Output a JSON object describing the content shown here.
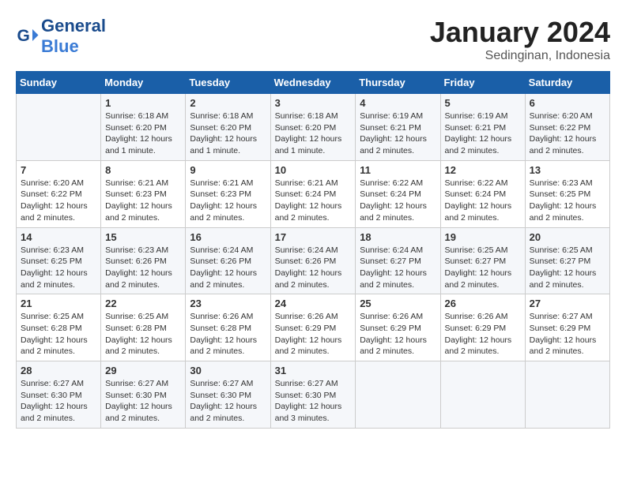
{
  "logo": {
    "general": "General",
    "blue": "Blue"
  },
  "title": "January 2024",
  "location": "Sedinginan, Indonesia",
  "days": [
    "Sunday",
    "Monday",
    "Tuesday",
    "Wednesday",
    "Thursday",
    "Friday",
    "Saturday"
  ],
  "weeks": [
    [
      {
        "day": "",
        "content": ""
      },
      {
        "day": "1",
        "content": "Sunrise: 6:18 AM\nSunset: 6:20 PM\nDaylight: 12 hours\nand 1 minute."
      },
      {
        "day": "2",
        "content": "Sunrise: 6:18 AM\nSunset: 6:20 PM\nDaylight: 12 hours\nand 1 minute."
      },
      {
        "day": "3",
        "content": "Sunrise: 6:18 AM\nSunset: 6:20 PM\nDaylight: 12 hours\nand 1 minute."
      },
      {
        "day": "4",
        "content": "Sunrise: 6:19 AM\nSunset: 6:21 PM\nDaylight: 12 hours\nand 2 minutes."
      },
      {
        "day": "5",
        "content": "Sunrise: 6:19 AM\nSunset: 6:21 PM\nDaylight: 12 hours\nand 2 minutes."
      },
      {
        "day": "6",
        "content": "Sunrise: 6:20 AM\nSunset: 6:22 PM\nDaylight: 12 hours\nand 2 minutes."
      }
    ],
    [
      {
        "day": "7",
        "content": "Sunrise: 6:20 AM\nSunset: 6:22 PM\nDaylight: 12 hours\nand 2 minutes."
      },
      {
        "day": "8",
        "content": "Sunrise: 6:21 AM\nSunset: 6:23 PM\nDaylight: 12 hours\nand 2 minutes."
      },
      {
        "day": "9",
        "content": "Sunrise: 6:21 AM\nSunset: 6:23 PM\nDaylight: 12 hours\nand 2 minutes."
      },
      {
        "day": "10",
        "content": "Sunrise: 6:21 AM\nSunset: 6:24 PM\nDaylight: 12 hours\nand 2 minutes."
      },
      {
        "day": "11",
        "content": "Sunrise: 6:22 AM\nSunset: 6:24 PM\nDaylight: 12 hours\nand 2 minutes."
      },
      {
        "day": "12",
        "content": "Sunrise: 6:22 AM\nSunset: 6:24 PM\nDaylight: 12 hours\nand 2 minutes."
      },
      {
        "day": "13",
        "content": "Sunrise: 6:23 AM\nSunset: 6:25 PM\nDaylight: 12 hours\nand 2 minutes."
      }
    ],
    [
      {
        "day": "14",
        "content": "Sunrise: 6:23 AM\nSunset: 6:25 PM\nDaylight: 12 hours\nand 2 minutes."
      },
      {
        "day": "15",
        "content": "Sunrise: 6:23 AM\nSunset: 6:26 PM\nDaylight: 12 hours\nand 2 minutes."
      },
      {
        "day": "16",
        "content": "Sunrise: 6:24 AM\nSunset: 6:26 PM\nDaylight: 12 hours\nand 2 minutes."
      },
      {
        "day": "17",
        "content": "Sunrise: 6:24 AM\nSunset: 6:26 PM\nDaylight: 12 hours\nand 2 minutes."
      },
      {
        "day": "18",
        "content": "Sunrise: 6:24 AM\nSunset: 6:27 PM\nDaylight: 12 hours\nand 2 minutes."
      },
      {
        "day": "19",
        "content": "Sunrise: 6:25 AM\nSunset: 6:27 PM\nDaylight: 12 hours\nand 2 minutes."
      },
      {
        "day": "20",
        "content": "Sunrise: 6:25 AM\nSunset: 6:27 PM\nDaylight: 12 hours\nand 2 minutes."
      }
    ],
    [
      {
        "day": "21",
        "content": "Sunrise: 6:25 AM\nSunset: 6:28 PM\nDaylight: 12 hours\nand 2 minutes."
      },
      {
        "day": "22",
        "content": "Sunrise: 6:25 AM\nSunset: 6:28 PM\nDaylight: 12 hours\nand 2 minutes."
      },
      {
        "day": "23",
        "content": "Sunrise: 6:26 AM\nSunset: 6:28 PM\nDaylight: 12 hours\nand 2 minutes."
      },
      {
        "day": "24",
        "content": "Sunrise: 6:26 AM\nSunset: 6:29 PM\nDaylight: 12 hours\nand 2 minutes."
      },
      {
        "day": "25",
        "content": "Sunrise: 6:26 AM\nSunset: 6:29 PM\nDaylight: 12 hours\nand 2 minutes."
      },
      {
        "day": "26",
        "content": "Sunrise: 6:26 AM\nSunset: 6:29 PM\nDaylight: 12 hours\nand 2 minutes."
      },
      {
        "day": "27",
        "content": "Sunrise: 6:27 AM\nSunset: 6:29 PM\nDaylight: 12 hours\nand 2 minutes."
      }
    ],
    [
      {
        "day": "28",
        "content": "Sunrise: 6:27 AM\nSunset: 6:30 PM\nDaylight: 12 hours\nand 2 minutes."
      },
      {
        "day": "29",
        "content": "Sunrise: 6:27 AM\nSunset: 6:30 PM\nDaylight: 12 hours\nand 2 minutes."
      },
      {
        "day": "30",
        "content": "Sunrise: 6:27 AM\nSunset: 6:30 PM\nDaylight: 12 hours\nand 2 minutes."
      },
      {
        "day": "31",
        "content": "Sunrise: 6:27 AM\nSunset: 6:30 PM\nDaylight: 12 hours\nand 3 minutes."
      },
      {
        "day": "",
        "content": ""
      },
      {
        "day": "",
        "content": ""
      },
      {
        "day": "",
        "content": ""
      }
    ]
  ]
}
